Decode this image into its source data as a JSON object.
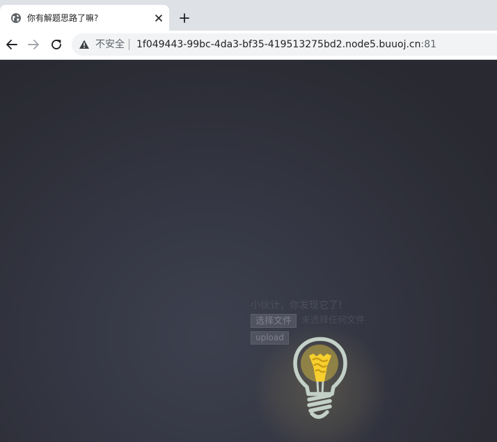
{
  "browser": {
    "tab": {
      "title": "你有解题思路了嘛?",
      "favicon": "globe-icon"
    },
    "new_tab_label": "+",
    "address_bar": {
      "security_label": "不安全",
      "url_host": "1f049443-99bc-4da3-bf35-419513275bd2.node5.buuoj.cn",
      "url_port": ":81"
    }
  },
  "page": {
    "hint_text": "小伙计，你发现它了!",
    "file_input": {
      "button_label": "选择文件",
      "status_text": "未选择任何文件"
    },
    "upload_button_label": "upload",
    "bulb_icon": "lightbulb-icon"
  },
  "colors": {
    "page_background": "#2a2b33",
    "bulb_yellow": "#f7cf2e",
    "bulb_outline": "#c3d0c7"
  }
}
